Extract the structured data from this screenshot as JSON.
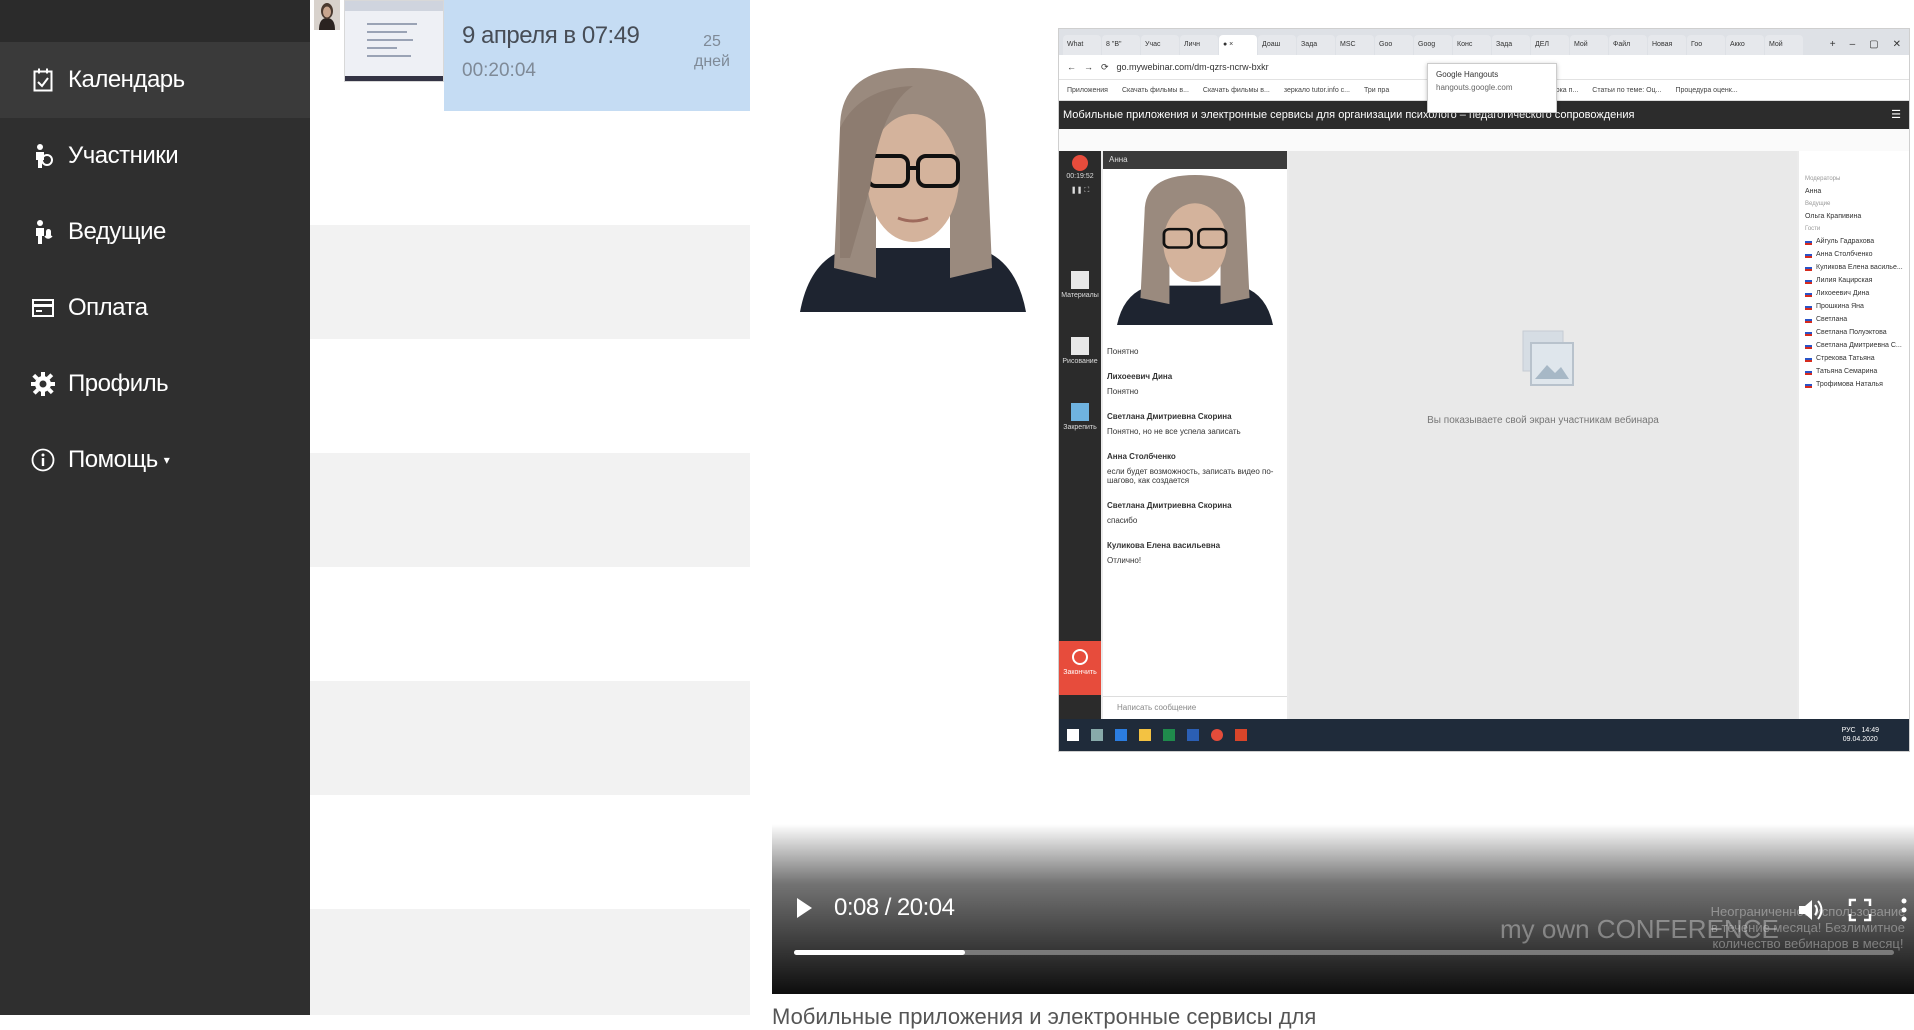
{
  "nav": {
    "items": [
      {
        "label": "Календарь",
        "icon": "calendar-check-icon",
        "active": true
      },
      {
        "label": "Участники",
        "icon": "participants-icon"
      },
      {
        "label": "Ведущие",
        "icon": "microphone-icon"
      },
      {
        "label": "Оплата",
        "icon": "credit-card-icon"
      },
      {
        "label": "Профиль",
        "icon": "gear-icon"
      },
      {
        "label": "Помощь",
        "icon": "info-icon",
        "caret": "▾"
      }
    ]
  },
  "recordings": {
    "selected": {
      "date": "9 апреля в 07:49",
      "duration": "00:20:04",
      "days_count": "25",
      "days_label": "дней"
    }
  },
  "player": {
    "current_time": "0:08",
    "separator": "/",
    "total_time": "20:04",
    "progress_fraction": 0.155,
    "watermark": {
      "brand": "my own CONFERENCE",
      "text": "Неограниченное использование в течение месяца! Безлимитное количество вебинаров в месяц!"
    },
    "caption": "Мобильные приложения и электронные сервисы для"
  },
  "screen_share": {
    "tabs": [
      "What",
      "8 \"В\"",
      "Учас",
      "Личн",
      "●  ×",
      "Доаш",
      "Зада",
      "MSC",
      "Goo",
      "Goog",
      "Конс",
      "Зада",
      "ДЕЛ",
      "Мой",
      "Файл",
      "Новая",
      "Гоо",
      "Акко",
      "Мой"
    ],
    "url": "go.mywebinar.com/dm-qzrs-ncrw-bxkr",
    "bookmarks": [
      "Приложения",
      "Скачать фильмы в...",
      "Скачать фильмы в...",
      "зеркало tutor.info с...",
      "Три пра",
      "Структура урока п...",
      "Статьи по теме: Оц...",
      "Процедура оценк..."
    ],
    "tooltip_title": "Google Hangouts",
    "tooltip_url": "hangouts.google.com",
    "webinar_title": "Мобильные приложения и электронные сервисы для организации психолого – педагогического сопровождения",
    "timer": "00:19:52",
    "cam_name": "Анна",
    "tools": [
      "Материалы",
      "Рисование",
      "Закрепить"
    ],
    "record_label": "Закончить",
    "chat": [
      {
        "text": "Понятно"
      },
      {
        "who": "Лихоеевич Дина",
        "text": "Понятно"
      },
      {
        "who": "Светлана Дмитриевна Скорина",
        "text": "Понятно, но не все успела записать"
      },
      {
        "who": "Анна Столбченко",
        "text": "если будет возможность, записать видео по-шагово, как создается"
      },
      {
        "who": "Светлана Дмитриевна Скорина",
        "text": "спасибо"
      },
      {
        "who": "Куликова Елена васильевна",
        "text": "Отлично!"
      }
    ],
    "chat_placeholder": "Написать сообщение",
    "stage_message": "Вы показываете свой экран участникам вебинара",
    "moderators_label": "Модераторы",
    "moderator": "Анна",
    "speakers_label": "Ведущие",
    "speaker": "Ольга Крапивина",
    "guests_label": "Гости",
    "guests": [
      "Айгуль Гадрахова",
      "Анна Столбченко",
      "Куликова Елена василье...",
      "Лилия Кацирская",
      "Лихоеевич Дина",
      "Прошкина Яна",
      "Светлана",
      "Светлана Полуэктова",
      "Светлана Дмитриевна С...",
      "Стрекова Татьяна",
      "Татьяна Семарина",
      "Трофимова Наталья"
    ],
    "clock_time": "14:49",
    "clock_date": "09.04.2020",
    "lang": "РУС"
  },
  "colors": {
    "sidebar_bg": "#2f2f2f",
    "selected_row": "#c5dcf3",
    "stripe": "#f2f2f2",
    "record_red": "#e74c3c"
  }
}
